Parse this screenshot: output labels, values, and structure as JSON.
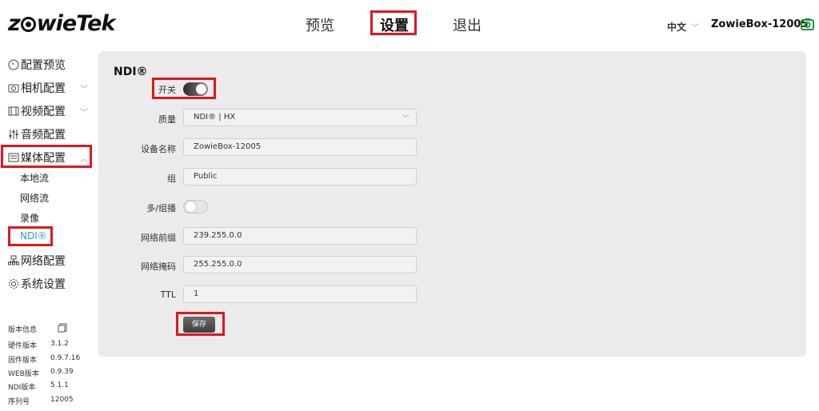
{
  "header": {
    "logo": {
      "pre": "z",
      "post": "wieTek"
    },
    "nav": [
      "预览",
      "设置",
      "退出"
    ],
    "language": "中文",
    "device_name": "ZowieBox-12005"
  },
  "sidebar": {
    "items": [
      {
        "label": "配置预览",
        "icon": "gauge-icon"
      },
      {
        "label": "相机配置",
        "icon": "camera-icon"
      },
      {
        "label": "视频配置",
        "icon": "film-icon"
      },
      {
        "label": "音频配置",
        "icon": "sliders-icon"
      },
      {
        "label": "媒体配置",
        "icon": "media-icon"
      },
      {
        "label": "网络配置",
        "icon": "network-icon"
      },
      {
        "label": "系统设置",
        "icon": "gear-icon"
      }
    ],
    "media_sub": [
      "本地流",
      "网络流",
      "录像",
      "NDI®"
    ]
  },
  "version": {
    "title": "版本信息",
    "rows": [
      {
        "label": "硬件版本",
        "value": "3.1.2"
      },
      {
        "label": "固件版本",
        "value": "0.9.7.16"
      },
      {
        "label": "WEB版本",
        "value": "0.9.39"
      },
      {
        "label": "NDI版本",
        "value": "5.1.1"
      },
      {
        "label": "序列号",
        "value": "12005"
      }
    ]
  },
  "ndi": {
    "title": "NDI®",
    "switch_label": "开关",
    "switch_on": true,
    "quality_label": "质量",
    "quality_value": "NDI® | HX",
    "device_name_label": "设备名称",
    "device_name_value": "ZowieBox-12005",
    "group_label": "组",
    "group_value": "Public",
    "multicast_label": "多/组播",
    "multicast_on": false,
    "net_prefix_label": "网络前缀",
    "net_prefix_value": "239.255.0.0",
    "net_mask_label": "网络掩码",
    "net_mask_value": "255.255.0.0",
    "ttl_label": "TTL",
    "ttl_value": "1",
    "save_label": "保存"
  },
  "colors": {
    "highlight_box": "#e0161f",
    "active_sub": "#1fa3d8",
    "panel_bg": "#ebebeb"
  }
}
